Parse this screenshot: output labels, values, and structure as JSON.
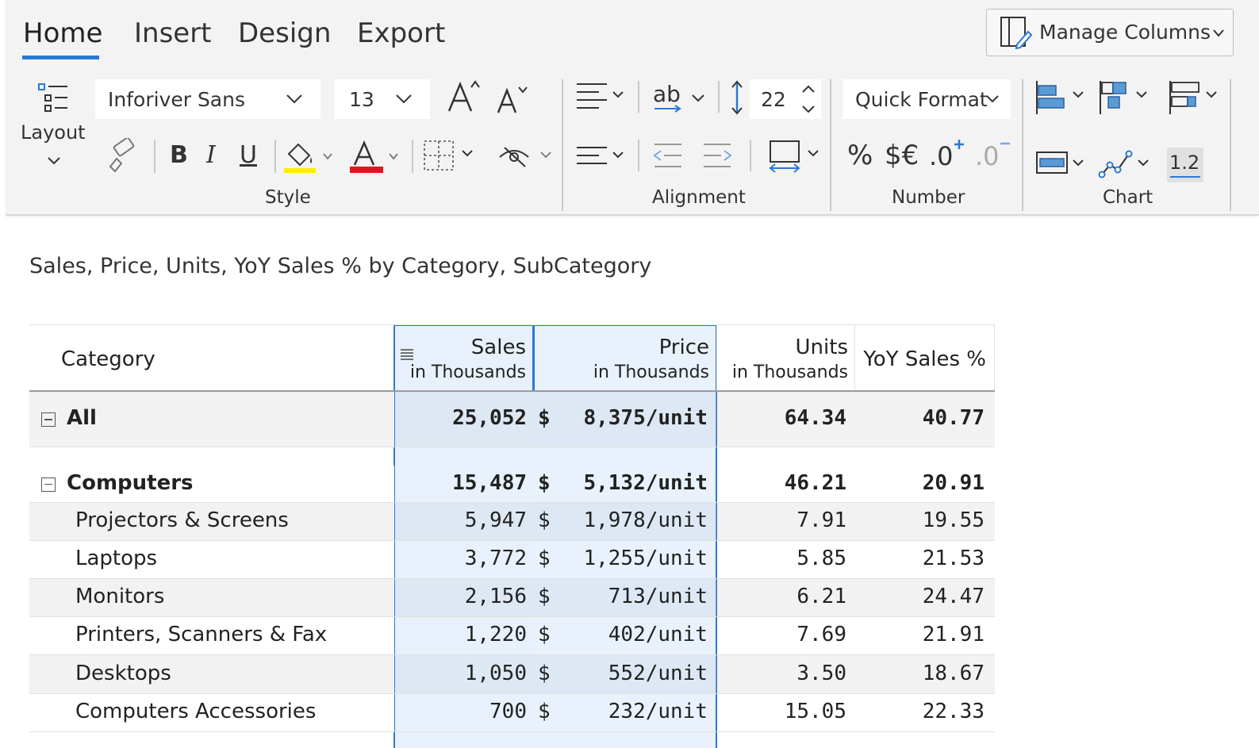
{
  "ribbon": {
    "tabs": [
      {
        "label": "Home",
        "active": true
      },
      {
        "label": "Insert",
        "active": false
      },
      {
        "label": "Design",
        "active": false
      },
      {
        "label": "Export",
        "active": false
      }
    ],
    "manage_columns_label": "Manage Columns",
    "layout_label": "Layout",
    "font_family": "Inforiver Sans",
    "font_size": "13",
    "line_height": "22",
    "quick_format_label": "Quick Format",
    "bold_glyph": "B",
    "italic_glyph": "I",
    "underline_glyph": "U",
    "ab_glyph": "ab",
    "percent_glyph": "%",
    "currency_glyph": "$€",
    "decimal_increase_glyph": ".0",
    "decimal_decrease_glyph": ".0",
    "data_label_glyph": "1.2",
    "groups": {
      "style": "Style",
      "alignment": "Alignment",
      "number": "Number",
      "chart": "Chart"
    },
    "colors": {
      "highlight": "#ffee00",
      "font_color": "#e0141e",
      "accent": "#2b79d6"
    }
  },
  "report": {
    "title": "Sales, Price, Units, YoY Sales % by Category, SubCategory",
    "columns": {
      "category": "Category",
      "sales": {
        "name": "Sales",
        "unit": "in Thousands"
      },
      "price": {
        "name": "Price",
        "unit": "in Thousands"
      },
      "units": {
        "name": "Units",
        "unit": "in Thousands"
      },
      "yoy": "YoY Sales %"
    },
    "rows": [
      {
        "label": "All",
        "sales": "25,052",
        "currency": "$",
        "price": "8,375/unit",
        "units": "64.34",
        "yoy": "40.77"
      },
      {
        "label": "Computers",
        "sales": "15,487",
        "currency": "$",
        "price": "5,132/unit",
        "units": "46.21",
        "yoy": "20.91"
      },
      {
        "label": "Projectors & Screens",
        "sales": "5,947",
        "currency": "$",
        "price": "1,978/unit",
        "units": "7.91",
        "yoy": "19.55"
      },
      {
        "label": "Laptops",
        "sales": "3,772",
        "currency": "$",
        "price": "1,255/unit",
        "units": "5.85",
        "yoy": "21.53"
      },
      {
        "label": "Monitors",
        "sales": "2,156",
        "currency": "$",
        "price": "713/unit",
        "units": "6.21",
        "yoy": "24.47"
      },
      {
        "label": "Printers, Scanners & Fax",
        "sales": "1,220",
        "currency": "$",
        "price": "402/unit",
        "units": "7.69",
        "yoy": "21.91"
      },
      {
        "label": "Desktops",
        "sales": "1,050",
        "currency": "$",
        "price": "552/unit",
        "units": "3.50",
        "yoy": "18.67"
      },
      {
        "label": "Computers Accessories",
        "sales": "700",
        "currency": "$",
        "price": "232/unit",
        "units": "15.05",
        "yoy": "22.33"
      }
    ]
  }
}
